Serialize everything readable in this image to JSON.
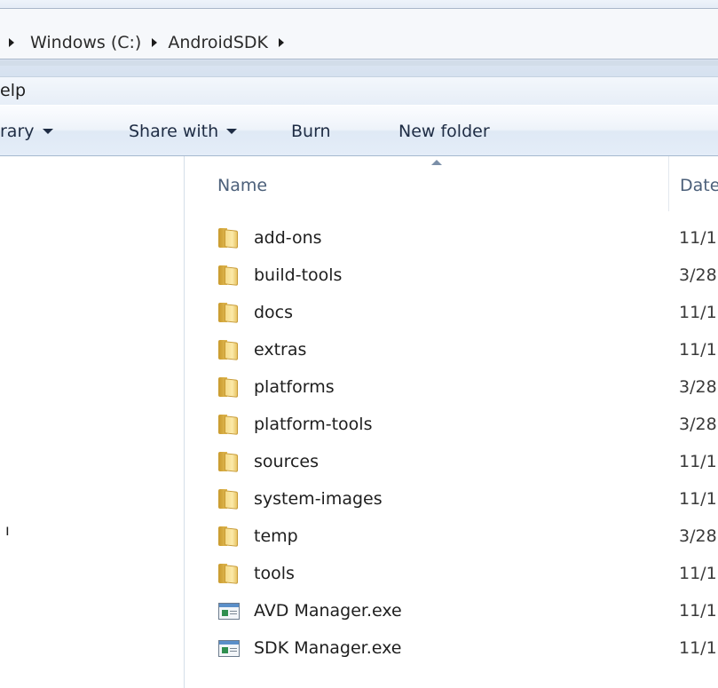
{
  "address_bar": {
    "breadcrumbs": [
      "Windows (C:)",
      "AndroidSDK"
    ]
  },
  "menu_bar": {
    "items": [
      "elp"
    ]
  },
  "command_bar": {
    "library_partial": "rary",
    "share_with": "Share with",
    "burn": "Burn",
    "new_folder": "New folder"
  },
  "nav_pane": {
    "partial_char": "ı"
  },
  "columns": {
    "name": "Name",
    "date": "Date"
  },
  "files": [
    {
      "name": "add-ons",
      "date": "11/1",
      "type": "folder"
    },
    {
      "name": "build-tools",
      "date": "3/28",
      "type": "folder"
    },
    {
      "name": "docs",
      "date": "11/1",
      "type": "folder"
    },
    {
      "name": "extras",
      "date": "11/1",
      "type": "folder"
    },
    {
      "name": "platforms",
      "date": "3/28",
      "type": "folder"
    },
    {
      "name": "platform-tools",
      "date": "3/28",
      "type": "folder"
    },
    {
      "name": "sources",
      "date": "11/1",
      "type": "folder"
    },
    {
      "name": "system-images",
      "date": "11/1",
      "type": "folder"
    },
    {
      "name": "temp",
      "date": "3/28",
      "type": "folder"
    },
    {
      "name": "tools",
      "date": "11/1",
      "type": "folder"
    },
    {
      "name": "AVD Manager.exe",
      "date": "11/1",
      "type": "application"
    },
    {
      "name": "SDK Manager.exe",
      "date": "11/1",
      "type": "application"
    }
  ],
  "icons": {
    "folder": "folder-icon",
    "application": "application-exe-icon",
    "breadcrumb_separator": "chevron-right-icon",
    "dropdown": "chevron-down-icon",
    "sort": "sort-ascending-icon"
  }
}
